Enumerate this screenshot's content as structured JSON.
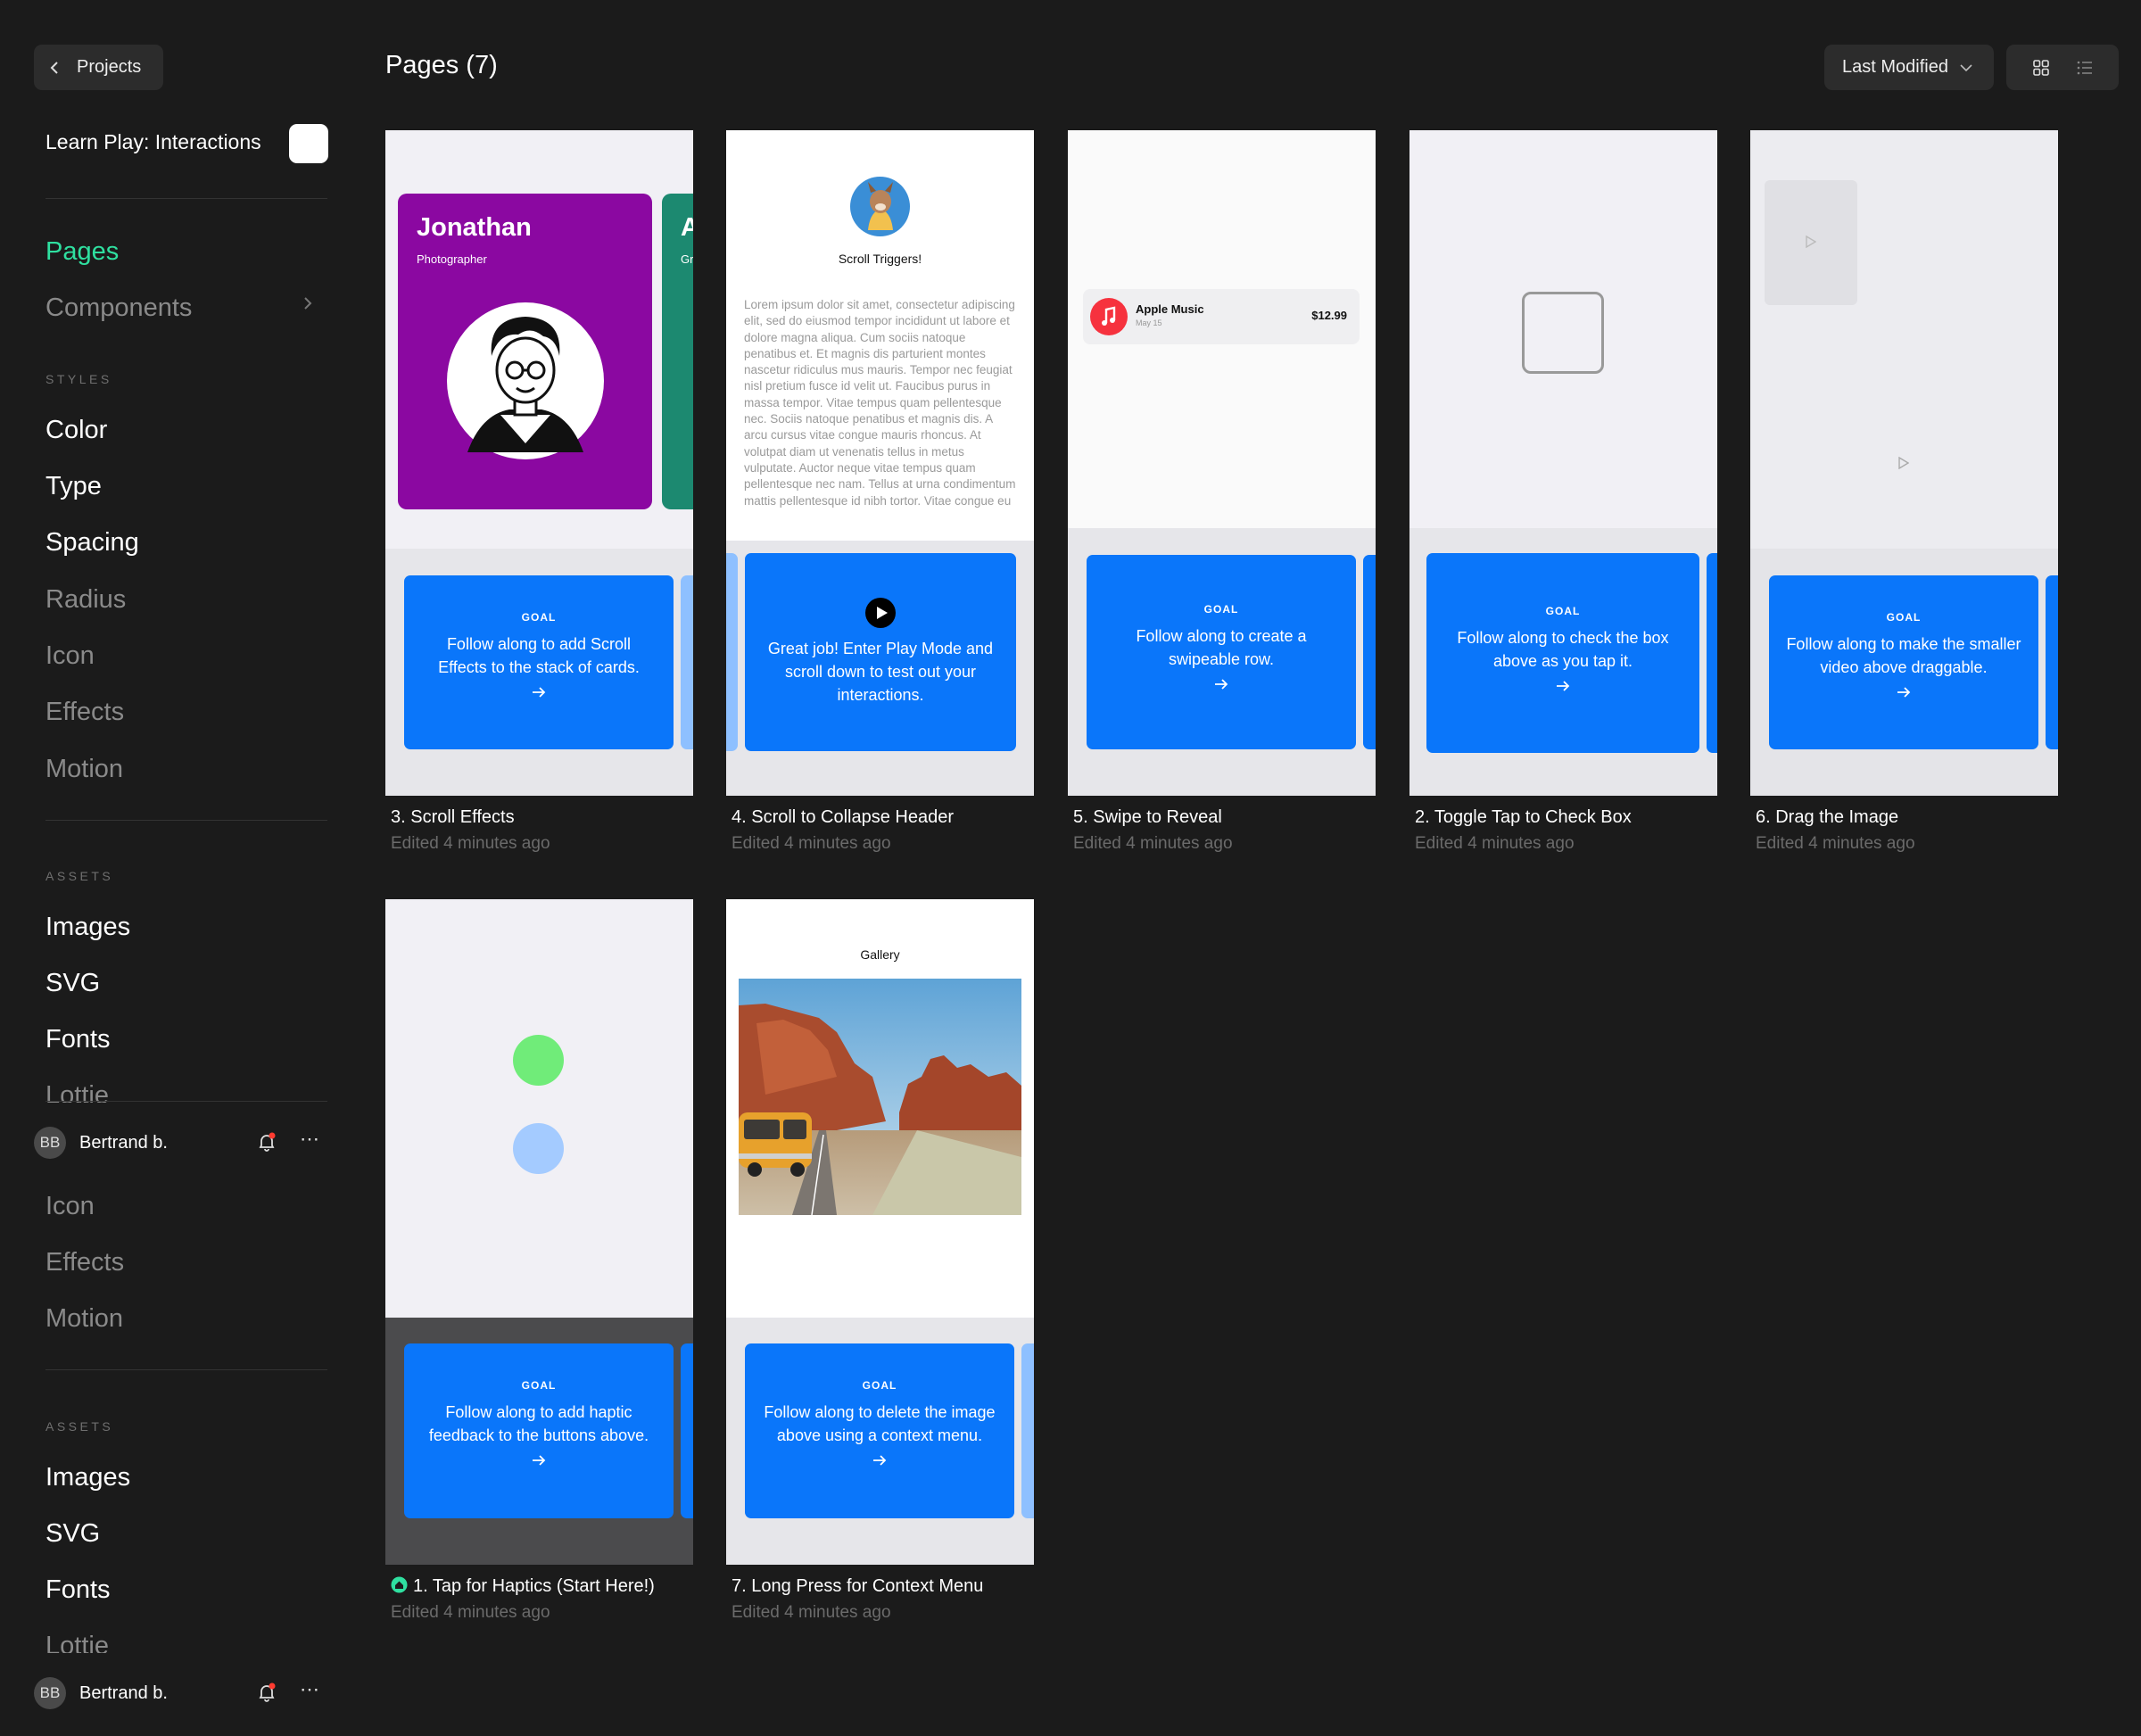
{
  "sidebar": {
    "back_label": "Projects",
    "project_title": "Learn Play: Interactions",
    "pages_label": "Pages",
    "components_label": "Components",
    "styles_section": "STYLES",
    "styles": [
      "Color",
      "Type",
      "Spacing",
      "Radius",
      "Icon",
      "Effects",
      "Motion"
    ],
    "assets_section": "ASSETS",
    "assets": [
      "Images",
      "SVG",
      "Fonts",
      "Lottie"
    ],
    "repeat_styles": [
      "Icon",
      "Effects",
      "Motion"
    ],
    "repeat_assets": [
      "Images",
      "SVG",
      "Fonts",
      "Lottie"
    ],
    "user": {
      "initials": "BB",
      "name": "Bertrand b."
    }
  },
  "header": {
    "title": "Pages (7)",
    "sort_label": "Last Modified"
  },
  "colors": {
    "accent": "#2fe0a0",
    "goal_blue": "#0a76fa",
    "purple": "#8b08a1"
  },
  "cards": [
    {
      "title": "3. Scroll Effects",
      "edited": "Edited 4 minutes ago",
      "person_name": "Jonathan",
      "person_role": "Photographer",
      "next_initial": "A",
      "next_role_abbr": "Gr",
      "goal_label": "GOAL",
      "goal_text": "Follow along to add Scroll Effects to the stack of cards."
    },
    {
      "title": "4. Scroll to Collapse Header",
      "edited": "Edited 4 minutes ago",
      "heading": "Scroll Triggers!",
      "lorem": "Lorem ipsum dolor sit amet, consectetur adipiscing elit, sed do eiusmod tempor incididunt ut labore et dolore magna aliqua. Cum sociis natoque penatibus et. Et magnis dis parturient montes nascetur ridiculus mus mauris. Tempor nec feugiat nisl pretium fusce id velit ut. Faucibus purus in massa tempor. Vitae tempus quam pellentesque nec. Sociis natoque penatibus et magnis dis. A arcu cursus vitae congue mauris rhoncus. At volutpat diam ut venenatis tellus in metus vulputate. Auctor neque vitae tempus quam pellentesque nec nam. Tellus at urna condimentum mattis pellentesque id nibh tortor. Vitae congue eu",
      "goal_text": "Great job! Enter Play Mode and scroll down to test out your interactions."
    },
    {
      "title": "5. Swipe to Reveal",
      "edited": "Edited 4 minutes ago",
      "row_title": "Apple Music",
      "row_date": "May 15",
      "row_price": "$12.99",
      "goal_label": "GOAL",
      "goal_text": "Follow along to create a swipeable row."
    },
    {
      "title": "2. Toggle Tap to Check Box",
      "edited": "Edited 4 minutes ago",
      "goal_label": "GOAL",
      "goal_text": "Follow along to check the box above as you tap it."
    },
    {
      "title": "6. Drag the Image",
      "edited": "Edited 4 minutes ago",
      "goal_label": "GOAL",
      "goal_text": "Follow along to make the smaller video above draggable."
    },
    {
      "title": "1. Tap for Haptics (Start Here!)",
      "edited": "Edited 4 minutes ago",
      "goal_label": "GOAL",
      "goal_text": "Follow along to add haptic feedback to the buttons above."
    },
    {
      "title": "7. Long Press for Context Menu",
      "edited": "Edited 4 minutes ago",
      "heading": "Gallery",
      "goal_label": "GOAL",
      "goal_text": "Follow along to delete the image above using a context menu."
    }
  ]
}
